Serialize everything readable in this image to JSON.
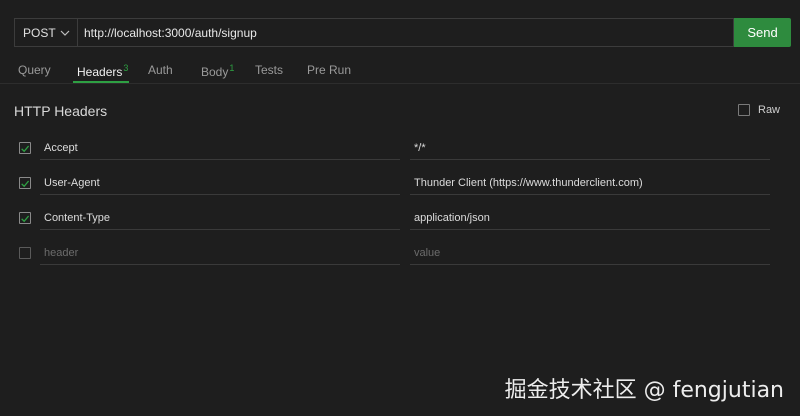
{
  "request": {
    "method": "POST",
    "url": "http://localhost:3000/auth/signup",
    "send_label": "Send"
  },
  "tabs": [
    {
      "label": "Query",
      "badge": ""
    },
    {
      "label": "Headers",
      "badge": "3"
    },
    {
      "label": "Auth",
      "badge": ""
    },
    {
      "label": "Body",
      "badge": "1"
    },
    {
      "label": "Tests",
      "badge": ""
    },
    {
      "label": "Pre Run",
      "badge": ""
    }
  ],
  "headers_section": {
    "title": "HTTP Headers",
    "raw_label": "Raw",
    "raw_checked": false,
    "rows": [
      {
        "key": "Accept",
        "value": "*/*",
        "checked": true
      },
      {
        "key": "User-Agent",
        "value": "Thunder Client (https://www.thunderclient.com)",
        "checked": true
      },
      {
        "key": "Content-Type",
        "value": "application/json",
        "checked": true
      }
    ],
    "new_row": {
      "key_placeholder": "header",
      "value_placeholder": "value",
      "checked": false
    }
  },
  "colors": {
    "accent": "#2ea043",
    "send_button": "#2e8b3e",
    "background": "#1e1e1e"
  },
  "watermark": "掘金技术社区 @ fengjutian"
}
